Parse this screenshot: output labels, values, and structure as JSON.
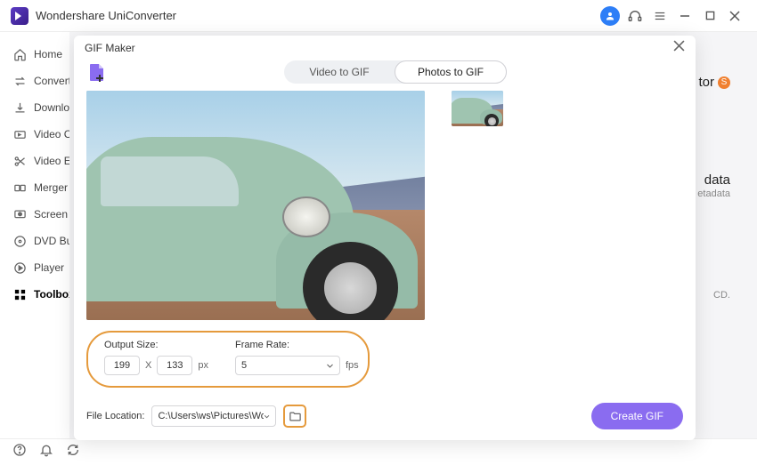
{
  "app": {
    "title": "Wondershare UniConverter"
  },
  "titlebar_icons": [
    "user",
    "headset",
    "menu",
    "minimize",
    "maximize",
    "close"
  ],
  "sidebar": {
    "items": [
      {
        "label": "Home",
        "icon": "home"
      },
      {
        "label": "Converter",
        "icon": "convert"
      },
      {
        "label": "Downloader",
        "icon": "download"
      },
      {
        "label": "Video Compressor",
        "icon": "compress"
      },
      {
        "label": "Video Editor",
        "icon": "scissors"
      },
      {
        "label": "Merger",
        "icon": "merge"
      },
      {
        "label": "Screen Recorder",
        "icon": "record"
      },
      {
        "label": "DVD Burner",
        "icon": "disc"
      },
      {
        "label": "Player",
        "icon": "play"
      },
      {
        "label": "Toolbox",
        "icon": "grid",
        "active": true
      }
    ]
  },
  "background": {
    "frag1": "tor",
    "frag1_badge": "S",
    "frag2": "data",
    "frag3": "etadata",
    "frag4": "CD."
  },
  "modal": {
    "title": "GIF Maker",
    "tabs": {
      "video": "Video to GIF",
      "photos": "Photos to GIF",
      "active": "photos"
    },
    "output_size_label": "Output Size:",
    "output_width": "199",
    "output_height": "133",
    "px_label": "px",
    "x_label": "X",
    "frame_rate_label": "Frame Rate:",
    "frame_rate_value": "5",
    "fps_label": "fps",
    "file_location_label": "File Location:",
    "file_location_value": "C:\\Users\\ws\\Pictures\\Wonders",
    "create_button": "Create GIF"
  },
  "statusbar": {
    "icons": [
      "help",
      "bell",
      "reset"
    ]
  }
}
